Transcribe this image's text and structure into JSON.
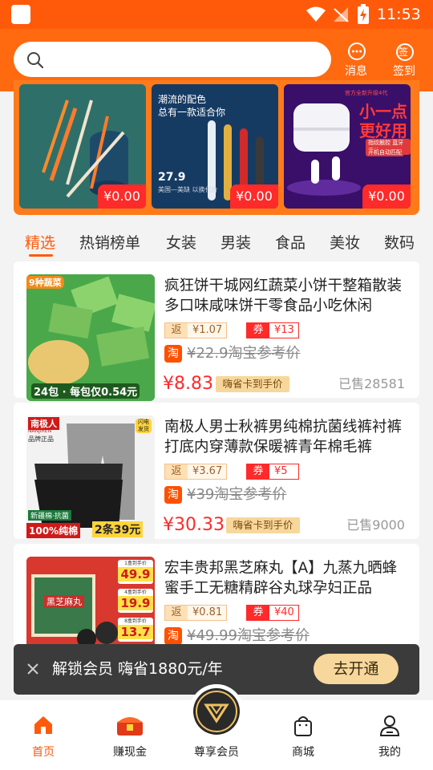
{
  "status_bar": {
    "time": "11:53"
  },
  "header": {
    "search_placeholder": "",
    "messages_label": "消息",
    "checkin_label": "签到",
    "checkin_icon_text": "签"
  },
  "banner": {
    "items": [
      {
        "price": "¥0.00"
      },
      {
        "price": "¥0.00",
        "caption1": "潮流的配色",
        "caption2": "总有一款适合你",
        "figure": "27.9",
        "small": "美国—美缺 以换代价"
      },
      {
        "price": "¥0.00",
        "top_text": "官方全新升级4代",
        "headline1": "小一点",
        "headline2": "更好用",
        "tag1": "指纹触控 蓝牙音效",
        "tag2": "开机自动匹配"
      }
    ]
  },
  "tabs": [
    "精选",
    "热销榜单",
    "女装",
    "男装",
    "食品",
    "美妆",
    "数码"
  ],
  "products": [
    {
      "title": "疯狂饼干城网红蔬菜小饼干整箱散装多口味咸味饼干零食品小吃休闲",
      "rebate_label": "返",
      "rebate": "¥1.07",
      "coupon_label": "券",
      "coupon": "¥13",
      "tao_icon": "淘",
      "ref_price": "¥22.9淘宝参考价",
      "price": "¥8.83",
      "badge": "嗨省卡到手价",
      "sold": "已售28581",
      "img_tag": "9种蔬菜",
      "img_caption": "24包 · 每包仅0.54元"
    },
    {
      "title": "南极人男士秋裤男纯棉抗菌线裤衬裤打底内穿薄款保暖裤青年棉毛裤",
      "rebate_label": "返",
      "rebate": "¥3.67",
      "coupon_label": "券",
      "coupon": "¥5",
      "tao_icon": "淘",
      "ref_price": "¥39淘宝参考价",
      "price": "¥30.33",
      "badge": "嗨省卡到手价",
      "sold": "已售9000",
      "img_brand1": "南极人",
      "img_brand2": "NANJIREN",
      "img_brand3": "品牌正品",
      "img_flash": "闪电发货",
      "img_tag": "新疆棉·抗菌",
      "img_caption_left": "100%纯棉",
      "img_caption_right": "2条39元"
    },
    {
      "title": "宏丰贵邦黑芝麻丸【A】九蒸九晒蜂蜜手工无糖精辟谷丸球孕妇正品",
      "rebate_label": "返",
      "rebate": "¥0.81",
      "coupon_label": "券",
      "coupon": "¥40",
      "tao_icon": "淘",
      "ref_price": "¥49.99淘宝参考价",
      "img_box": "黑芝麻丸",
      "img_p1_label": "1盒到手价",
      "img_p1": "49.9",
      "img_p2_label": "4盒到手价",
      "img_p2": "19.9",
      "img_p3_label": "8盒到手价",
      "img_p3": "13.7"
    }
  ],
  "vip_bar": {
    "text": "解锁会员 嗨省1880元/年",
    "button": "去开通"
  },
  "bottom_nav": [
    "首页",
    "赚现金",
    "尊享会员",
    "商城",
    "我的"
  ],
  "colors": {
    "accent": "#ff5a0a",
    "price_red": "#ff2a2a",
    "gold": "#f7d79b",
    "dark_bar": "#3b3b3b"
  }
}
